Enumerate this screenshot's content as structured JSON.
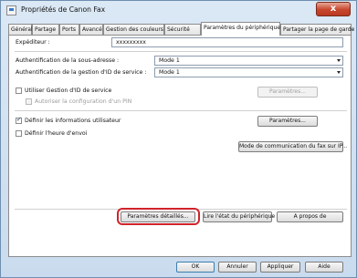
{
  "window": {
    "title": "Propriétés de Canon Fax",
    "close_label": "x"
  },
  "tabs": [
    "Général",
    "Partage",
    "Ports",
    "Avancé",
    "Gestion des couleurs",
    "Sécurité",
    "Paramètres du périphérique",
    "Partager la page de garde"
  ],
  "device": {
    "sender_label": "Expéditeur :",
    "sender_value": "xxxxxxxxx",
    "subaddress_label": "Authentification de la sous-adresse :",
    "subaddress_value": "Mode 1",
    "dept_id_label": "Authentification de la gestion d'ID de service :",
    "dept_id_value": "Mode 1",
    "use_dept_id_label": "Utiliser Gestion d'ID de service",
    "use_dept_id_checked": false,
    "dept_params_button": "Paramètres...",
    "allow_pin_label": "Autoriser la configuration d'un PIN",
    "allow_pin_checked": false,
    "user_info_label": "Définir les informations utilisateur",
    "user_info_checked": true,
    "user_params_button": "Paramètres...",
    "send_time_label": "Définir l'heure d'envoi",
    "send_time_checked": false,
    "fax_comm_mode_button": "Mode de communication du fax sur IP...",
    "detailed_settings_button": "Paramètres détaillés...",
    "read_device_button": "Lire l'état du périphérique",
    "about_button": "A propos de"
  },
  "footer": {
    "ok": "OK",
    "cancel": "Annuler",
    "apply": "Appliquer",
    "help": "Aide"
  }
}
